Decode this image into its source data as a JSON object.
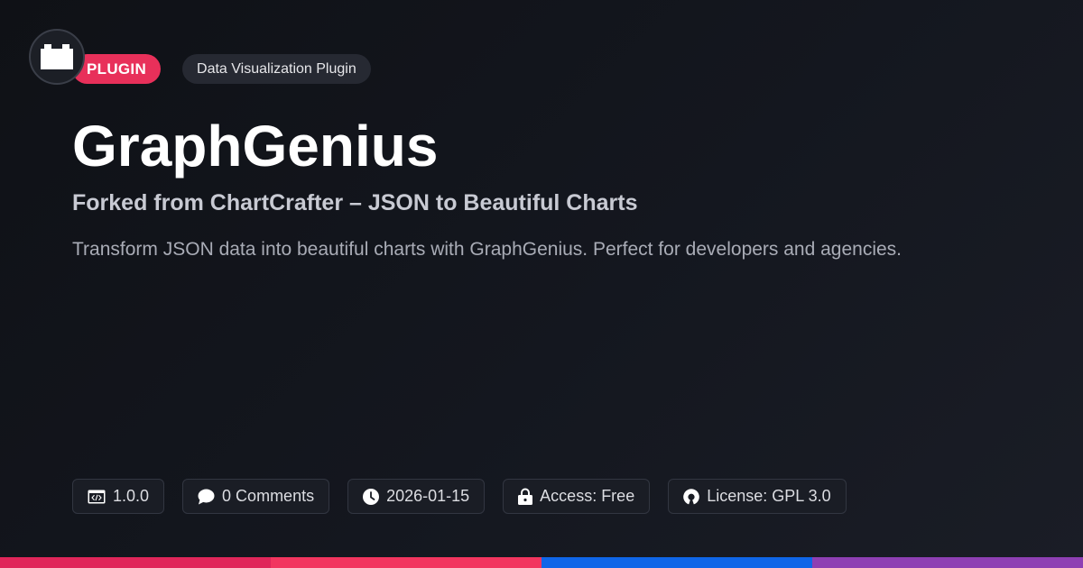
{
  "badges": {
    "type": "PLUGIN",
    "category": "Data Visualization Plugin"
  },
  "title": "GraphGenius",
  "subtitle": "Forked from ChartCrafter – JSON to Beautiful Charts",
  "description": "Transform JSON data into beautiful charts with GraphGenius. Perfect for developers and agencies.",
  "meta": {
    "version": "1.0.0",
    "comments": "0 Comments",
    "date": "2026-01-15",
    "access": "Access: Free",
    "license": "License: GPL 3.0"
  },
  "icons": {
    "logo": "plugin-block-icon",
    "version": "code-window-icon",
    "comments": "speech-bubble-icon",
    "date": "clock-icon",
    "access": "lock-icon",
    "license": "open-source-icon"
  },
  "colors": {
    "accent": "#e8305a",
    "bar": [
      "#e0265a",
      "#f2355f",
      "#0f66e8",
      "#8e3fb3"
    ]
  }
}
